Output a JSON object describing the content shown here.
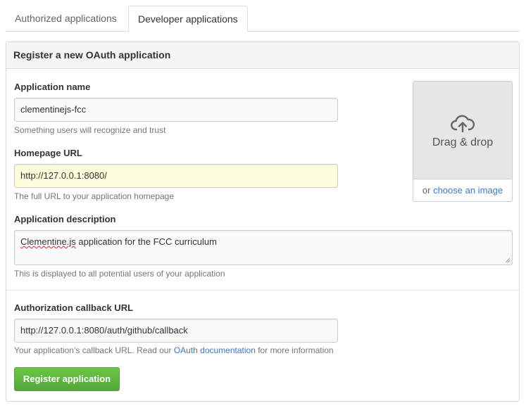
{
  "tabs": [
    {
      "label": "Authorized applications",
      "active": false
    },
    {
      "label": "Developer applications",
      "active": true
    }
  ],
  "panel": {
    "title": "Register a new OAuth application"
  },
  "form": {
    "app_name": {
      "label": "Application name",
      "value": "clementinejs-fcc",
      "hint": "Something users will recognize and trust"
    },
    "homepage": {
      "label": "Homepage URL",
      "value": "http://127.0.0.1:8080/",
      "hint": "The full URL to your application homepage"
    },
    "description": {
      "label": "Application description",
      "value_spelled": "Clementine.js",
      "value_rest": " application for the FCC curriculum",
      "hint": "This is displayed to all potential users of your application"
    },
    "callback": {
      "label": "Authorization callback URL",
      "value": "http://127.0.0.1:8080/auth/github/callback",
      "hint_prefix": "Your application’s callback URL. Read our ",
      "hint_link": "OAuth documentation",
      "hint_suffix": " for more information"
    }
  },
  "upload": {
    "drop_text": "Drag & drop",
    "or_text": "or ",
    "link_text": "choose an image",
    "icon": "cloud-upload-icon"
  },
  "submit": {
    "label": "Register application"
  },
  "colors": {
    "link": "#4078c0",
    "button": "#6cc644",
    "highlight_input": "#ffffdd"
  }
}
